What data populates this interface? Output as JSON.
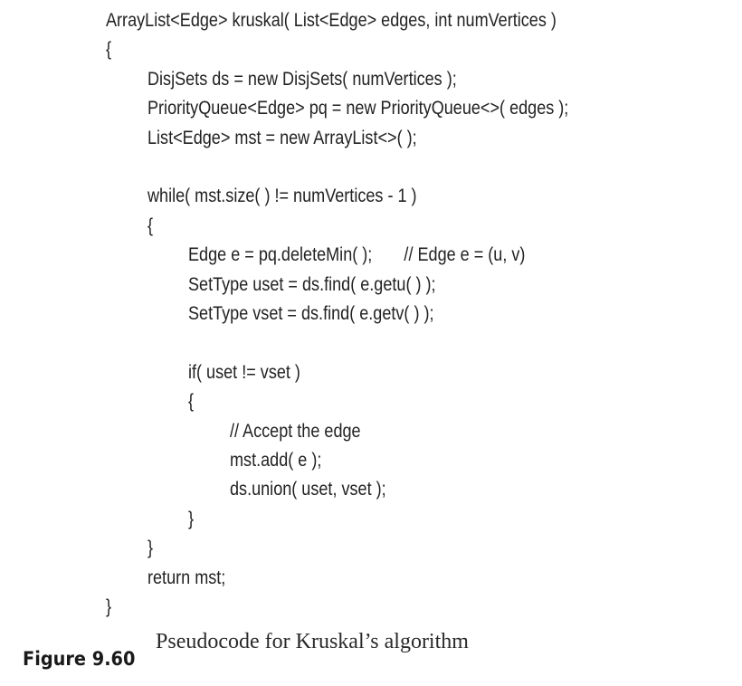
{
  "figure": {
    "code_lines": [
      {
        "indent": 0,
        "text": "ArrayList<Edge> kruskal( List<Edge> edges, int numVertices )"
      },
      {
        "indent": 0,
        "text": "{"
      },
      {
        "indent": 1,
        "text": "DisjSets ds = new DisjSets( numVertices );"
      },
      {
        "indent": 1,
        "text": "PriorityQueue<Edge> pq = new PriorityQueue<>( edges );"
      },
      {
        "indent": 1,
        "text": "List<Edge> mst = new ArrayList<>( );"
      },
      {
        "indent": 0,
        "text": ""
      },
      {
        "indent": 1,
        "text": "while( mst.size( ) != numVertices - 1 )"
      },
      {
        "indent": 1,
        "text": "{"
      },
      {
        "indent": 2,
        "text": "Edge e = pq.deleteMin( );       // Edge e = (u, v)"
      },
      {
        "indent": 2,
        "text": "SetType uset = ds.find( e.getu( ) );"
      },
      {
        "indent": 2,
        "text": "SetType vset = ds.find( e.getv( ) );"
      },
      {
        "indent": 0,
        "text": ""
      },
      {
        "indent": 2,
        "text": "if( uset != vset )"
      },
      {
        "indent": 2,
        "text": "{"
      },
      {
        "indent": 3,
        "text": "// Accept the edge"
      },
      {
        "indent": 3,
        "text": "mst.add( e );"
      },
      {
        "indent": 3,
        "text": "ds.union( uset, vset );"
      },
      {
        "indent": 2,
        "text": "}"
      },
      {
        "indent": 1,
        "text": "}"
      },
      {
        "indent": 1,
        "text": "return mst;"
      },
      {
        "indent": 0,
        "text": "}"
      }
    ],
    "caption_label": "Figure 9.60",
    "caption_text": "Pseudocode for Kruskal’s algorithm"
  }
}
